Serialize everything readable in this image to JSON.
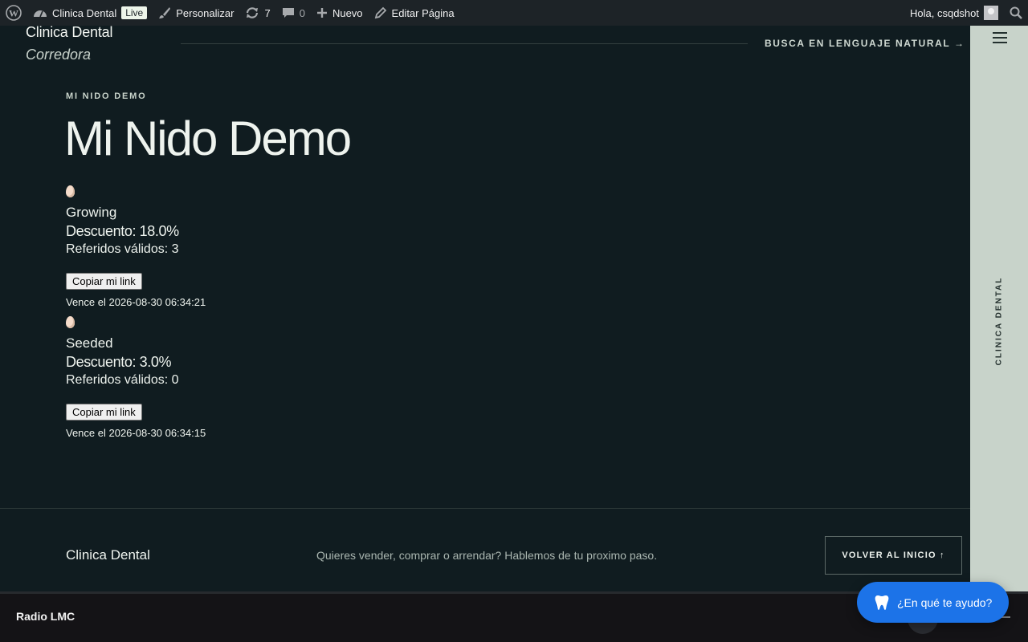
{
  "adminbar": {
    "site_name": "Clinica Dental",
    "live_badge": "Live",
    "customize": "Personalizar",
    "updates_count": "7",
    "comments_count": "0",
    "new_label": "Nuevo",
    "edit_page": "Editar Página",
    "greeting": "Hola, csqdshot"
  },
  "header": {
    "brand_title": "Clinica Dental",
    "brand_subtitle": "Corredora",
    "search_link": "BUSCA EN LENGUAJE NATURAL →"
  },
  "rail": {
    "vertical_text": "CLINICA DENTAL"
  },
  "main": {
    "eyebrow": "MI NIDO DEMO",
    "title": "Mi Nido Demo",
    "cards": [
      {
        "icon": "egg-icon",
        "stage": "Growing",
        "discount": "Descuento: 18.0%",
        "referrals": "Referidos válidos: 3",
        "button": "Copiar mi link",
        "expiry": "Vence el 2026-08-30 06:34:21"
      },
      {
        "icon": "egg-icon",
        "stage": "Seeded",
        "discount": "Descuento: 3.0%",
        "referrals": "Referidos válidos: 0",
        "button": "Copiar mi link",
        "expiry": "Vence el 2026-08-30 06:34:15"
      }
    ]
  },
  "footer": {
    "brand": "Clinica Dental",
    "cta": "Quieres vender, comprar o arrendar? Hablemos de tu proximo paso.",
    "back_button": "VOLVER AL INICIO ↑"
  },
  "player": {
    "station": "Radio LMC"
  },
  "chat": {
    "label": "¿En qué te ayudo?",
    "icon": "tooth-icon",
    "color": "#1c73e8"
  },
  "colors": {
    "background": "#101c20",
    "rail": "#c8d3ca",
    "adminbar": "#1d2327"
  }
}
